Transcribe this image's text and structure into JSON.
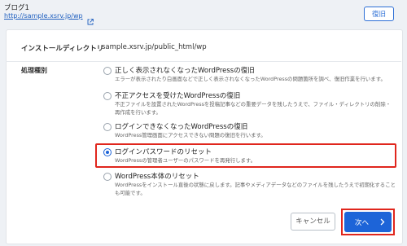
{
  "header": {
    "site_name": "ブログ1",
    "site_url": "http://sample.xsrv.jp/wp",
    "restore_label": "復旧"
  },
  "install_dir": {
    "label": "インストールディレクトリ",
    "value": "sample.xsrv.jp/public_html/wp"
  },
  "process_type": {
    "label": "処理種別",
    "options": [
      {
        "title": "正しく表示されなくなったWordPressの復旧",
        "desc": "エラーが表示されたり白画面などで正しく表示されなくなったWordPressの問題箇所を調べ、復旧作業を行います。"
      },
      {
        "title": "不正アクセスを受けたWordPressの復旧",
        "desc": "不正ファイルを設置されたWordPressを投稿記事などの重要データを残したうえで、ファイル・ディレクトリの削除・再作成を行います。"
      },
      {
        "title": "ログインできなくなったWordPressの復旧",
        "desc": "WordPress管理画面にアクセスできない問題の復旧を行います。"
      },
      {
        "title": "ログインパスワードのリセット",
        "desc": "WordPressの管理者ユーザーのパスワードを再発行します。"
      },
      {
        "title": "WordPress本体のリセット",
        "desc": "WordPressをインストール直後の状態に戻します。記事やメディアデータなどのファイルを残したうえで初期化することも可能です。"
      }
    ],
    "selected_index": 3
  },
  "footer": {
    "cancel_label": "キャンセル",
    "next_label": "次へ"
  },
  "colors": {
    "accent": "#1d64d8",
    "highlight": "#e0261d"
  }
}
